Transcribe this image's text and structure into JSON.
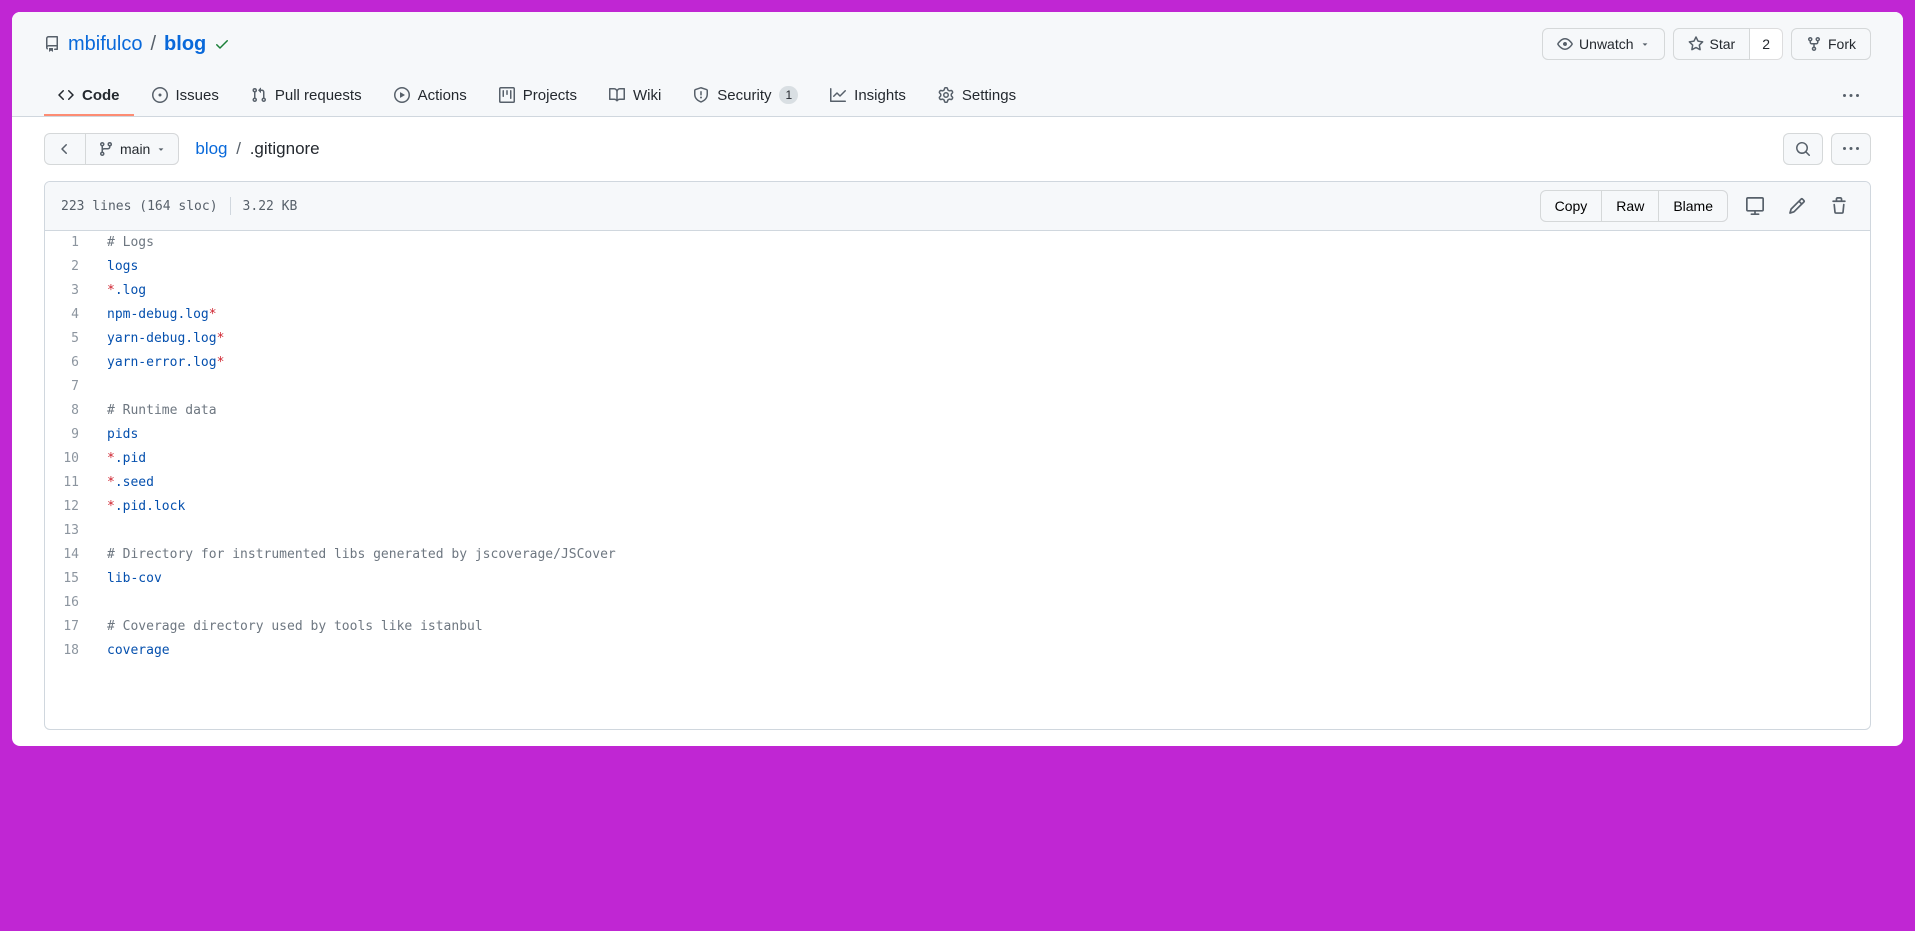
{
  "repo": {
    "owner": "mbifulco",
    "name": "blog"
  },
  "actions": {
    "watch": "Unwatch",
    "star": "Star",
    "star_count": "2",
    "fork": "Fork"
  },
  "tabs": {
    "code": "Code",
    "issues": "Issues",
    "pulls": "Pull requests",
    "actions": "Actions",
    "projects": "Projects",
    "wiki": "Wiki",
    "security": "Security",
    "security_count": "1",
    "insights": "Insights",
    "settings": "Settings"
  },
  "branch": "main",
  "breadcrumb": {
    "root": "blog",
    "file": ".gitignore"
  },
  "file_stats": {
    "lines": "223 lines (164 sloc)",
    "size": "3.22 KB"
  },
  "file_actions": {
    "copy": "Copy",
    "raw": "Raw",
    "blame": "Blame"
  },
  "code": [
    {
      "n": 1,
      "t": "comment",
      "s": "# Logs"
    },
    {
      "n": 2,
      "t": "keyword",
      "s": "logs"
    },
    {
      "n": 3,
      "t": "mixed",
      "pre": "*",
      "post": ".log"
    },
    {
      "n": 4,
      "t": "mixedr",
      "pre": "npm-debug.log",
      "post": "*"
    },
    {
      "n": 5,
      "t": "mixedr",
      "pre": "yarn-debug.log",
      "post": "*"
    },
    {
      "n": 6,
      "t": "mixedr",
      "pre": "yarn-error.log",
      "post": "*"
    },
    {
      "n": 7,
      "t": "blank",
      "s": ""
    },
    {
      "n": 8,
      "t": "comment",
      "s": "# Runtime data"
    },
    {
      "n": 9,
      "t": "keyword",
      "s": "pids"
    },
    {
      "n": 10,
      "t": "mixed",
      "pre": "*",
      "post": ".pid"
    },
    {
      "n": 11,
      "t": "mixed",
      "pre": "*",
      "post": ".seed"
    },
    {
      "n": 12,
      "t": "mixed",
      "pre": "*",
      "post": ".pid.lock"
    },
    {
      "n": 13,
      "t": "blank",
      "s": ""
    },
    {
      "n": 14,
      "t": "comment",
      "s": "# Directory for instrumented libs generated by jscoverage/JSCover"
    },
    {
      "n": 15,
      "t": "keyword",
      "s": "lib-cov"
    },
    {
      "n": 16,
      "t": "blank",
      "s": ""
    },
    {
      "n": 17,
      "t": "comment",
      "s": "# Coverage directory used by tools like istanbul"
    },
    {
      "n": 18,
      "t": "keyword",
      "s": "coverage"
    }
  ]
}
